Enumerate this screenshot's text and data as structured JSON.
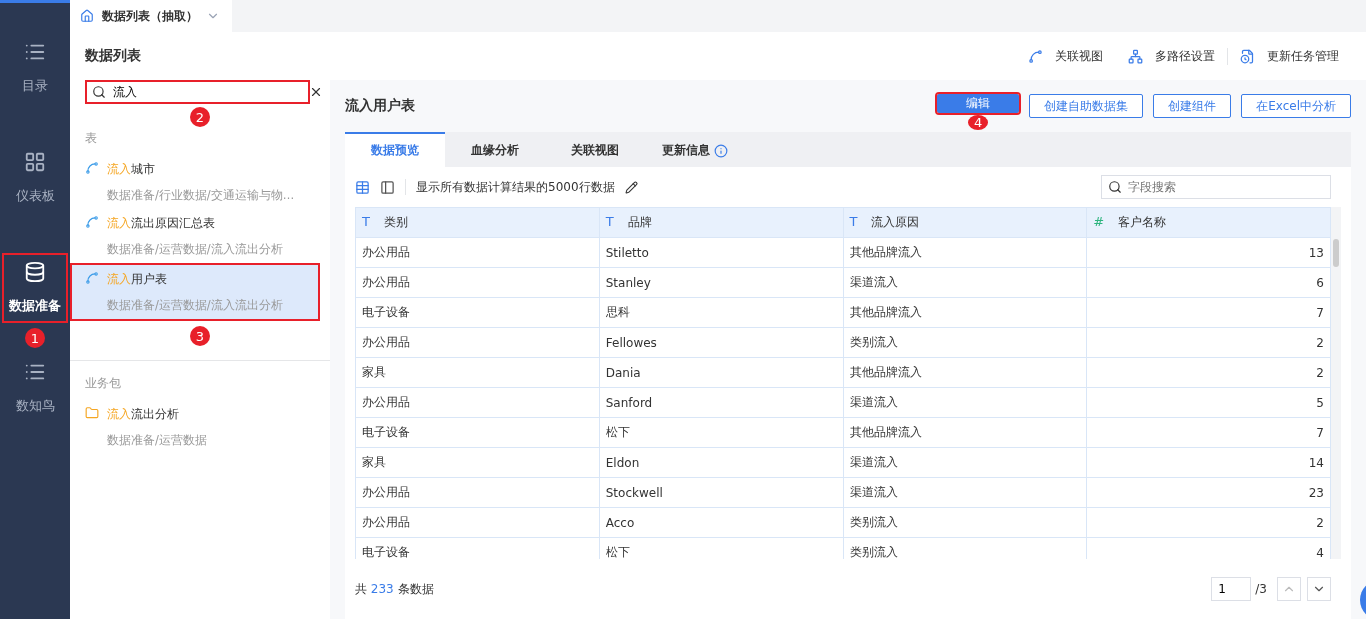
{
  "nav": [
    {
      "label": "目录",
      "selected": false,
      "highlighted": false
    },
    {
      "label": "仪表板",
      "selected": false,
      "highlighted": false
    },
    {
      "label": "数据准备",
      "selected": true,
      "highlighted": true,
      "callout": "1"
    },
    {
      "label": "数知鸟",
      "selected": false,
      "highlighted": false
    }
  ],
  "top_tab": {
    "label": "数据列表（抽取）"
  },
  "page_title": "数据列表",
  "actions": [
    {
      "label": "关联视图"
    },
    {
      "label": "多路径设置"
    },
    {
      "label": "更新任务管理"
    }
  ],
  "search": {
    "value": "流入",
    "highlighted": true,
    "callout": "2"
  },
  "table_section": {
    "title": "表",
    "items": [
      {
        "match": "流入",
        "name": "城市",
        "path": "数据准备/行业数据/交通运输与物…",
        "selected": false,
        "highlighted": false
      },
      {
        "match": "流入",
        "name": "流出原因汇总表",
        "path": "数据准备/运营数据/流入流出分析",
        "selected": false,
        "highlighted": false
      },
      {
        "match": "流入",
        "name": "用户表",
        "path": "数据准备/运营数据/流入流出分析",
        "selected": true,
        "highlighted": true,
        "callout": "3"
      }
    ]
  },
  "package_section": {
    "title": "业务包",
    "items": [
      {
        "match": "流入",
        "name": "流出分析",
        "path": "数据准备/运营数据"
      }
    ]
  },
  "detail": {
    "title": "流入用户表",
    "buttons": [
      {
        "label": "编辑",
        "primary": true,
        "highlighted": true,
        "callout": "4"
      },
      {
        "label": "创建自助数据集",
        "primary": false,
        "highlighted": false
      },
      {
        "label": "创建组件",
        "primary": false,
        "highlighted": false
      },
      {
        "label": "在Excel中分析",
        "primary": false,
        "highlighted": false
      }
    ],
    "tabs": [
      {
        "label": "数据预览",
        "selected": true,
        "info": false
      },
      {
        "label": "血缘分析",
        "selected": false,
        "info": false
      },
      {
        "label": "关联视图",
        "selected": false,
        "info": false
      },
      {
        "label": "更新信息",
        "selected": false,
        "info": true
      }
    ],
    "toolbar_text": "显示所有数据计算结果的5000行数据",
    "field_search": {
      "placeholder": "字段搜索"
    },
    "columns": [
      {
        "mark": "T",
        "label": "类别",
        "kind": "text"
      },
      {
        "mark": "T",
        "label": "品牌",
        "kind": "text"
      },
      {
        "mark": "T",
        "label": "流入原因",
        "kind": "text"
      },
      {
        "mark": "#",
        "label": "客户名称",
        "kind": "number"
      }
    ],
    "rows": [
      [
        "办公用品",
        "Stiletto",
        "其他品牌流入",
        "13"
      ],
      [
        "办公用品",
        "Stanley",
        "渠道流入",
        "6"
      ],
      [
        "电子设备",
        "思科",
        "其他品牌流入",
        "7"
      ],
      [
        "办公用品",
        "Fellowes",
        "类别流入",
        "2"
      ],
      [
        "家具",
        "Dania",
        "其他品牌流入",
        "2"
      ],
      [
        "办公用品",
        "Sanford",
        "渠道流入",
        "5"
      ],
      [
        "电子设备",
        "松下",
        "其他品牌流入",
        "7"
      ],
      [
        "家具",
        "Eldon",
        "渠道流入",
        "14"
      ],
      [
        "办公用品",
        "Stockwell",
        "渠道流入",
        "23"
      ],
      [
        "办公用品",
        "Acco",
        "类别流入",
        "2"
      ],
      [
        "电子设备",
        "松下",
        "类别流入",
        "4"
      ]
    ],
    "footer": {
      "prefix": "共",
      "count": "233",
      "suffix": "条数据"
    },
    "pager": {
      "page": "1",
      "total": "/3"
    }
  }
}
